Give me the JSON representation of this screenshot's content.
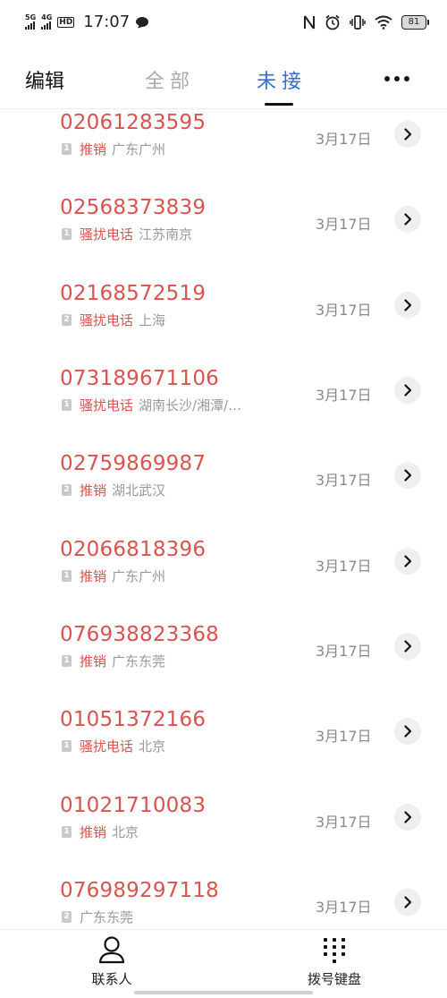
{
  "status_bar": {
    "sim1_label": "5G",
    "sim2_label": "4G",
    "hd_label": "HD",
    "time": "17:07",
    "battery_level": "81",
    "icons": [
      "signal-icon",
      "hd-icon",
      "message-icon",
      "nfc-icon",
      "alarm-icon",
      "vibrate-icon",
      "wifi-icon",
      "battery-icon"
    ]
  },
  "top_nav": {
    "edit_label": "编辑",
    "tabs": [
      {
        "label": "全部",
        "selected": false
      },
      {
        "label": "未接",
        "selected": true
      }
    ],
    "accent_color": "#2f6fd3"
  },
  "colors": {
    "missed_red": "#d9534f",
    "secondary_gray": "#999999"
  },
  "calls": [
    {
      "number": "02061283595",
      "sim": "1",
      "tag": "推销",
      "location": "广东广州",
      "date": "3月17日"
    },
    {
      "number": "02568373839",
      "sim": "1",
      "tag": "骚扰电话",
      "location": "江苏南京",
      "date": "3月17日"
    },
    {
      "number": "02168572519",
      "sim": "2",
      "tag": "骚扰电话",
      "location": "上海",
      "date": "3月17日"
    },
    {
      "number": "073189671106",
      "sim": "1",
      "tag": "骚扰电话",
      "location": "湖南长沙/湘潭/…",
      "date": "3月17日"
    },
    {
      "number": "02759869987",
      "sim": "2",
      "tag": "推销",
      "location": "湖北武汉",
      "date": "3月17日"
    },
    {
      "number": "02066818396",
      "sim": "1",
      "tag": "推销",
      "location": "广东广州",
      "date": "3月17日"
    },
    {
      "number": "076938823368",
      "sim": "1",
      "tag": "推销",
      "location": "广东东莞",
      "date": "3月17日"
    },
    {
      "number": "01051372166",
      "sim": "1",
      "tag": "骚扰电话",
      "location": "北京",
      "date": "3月17日"
    },
    {
      "number": "01021710083",
      "sim": "1",
      "tag": "推销",
      "location": "北京",
      "date": "3月17日"
    },
    {
      "number": "076989297118",
      "sim": "2",
      "tag": "",
      "location": "广东东莞",
      "date": "3月17日"
    }
  ],
  "bottom_bar": {
    "contacts_label": "联系人",
    "dialpad_label": "拨号键盘"
  }
}
